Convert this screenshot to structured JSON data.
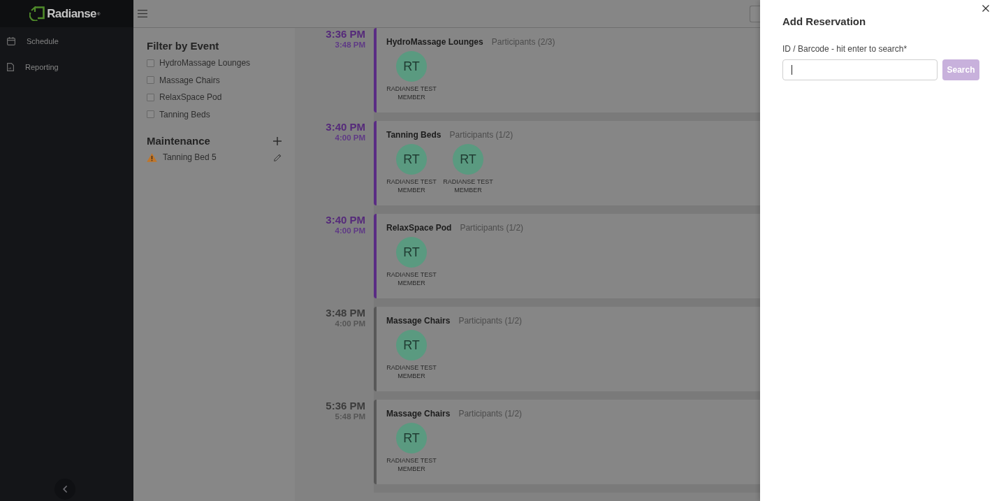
{
  "sidebar": {
    "logo": "Radianse$^{®}$",
    "items": [
      {
        "label": "Schedule",
        "kind": "calendar",
        "selected": false
      },
      {
        "label": "Reporting",
        "kind": "document",
        "selected": false
      }
    ]
  },
  "filter": {
    "title": "Filter by Event",
    "options": [
      {
        "label": "HydroMassage Lounges",
        "checked": false
      },
      {
        "label": "Massage Chairs",
        "checked": false
      },
      {
        "label": "RelaxSpace Pod",
        "checked": false
      },
      {
        "label": "Tanning Beds",
        "checked": false
      }
    ]
  },
  "maintenance": {
    "title": "Maintenance",
    "items": [
      {
        "label": "Tanning Bed 5"
      }
    ]
  },
  "events": [
    {
      "start": "3:36 PM",
      "end": "3:48 PM",
      "highlighted": true,
      "title": "HydroMassage Lounges",
      "participants_label": "Participants (2/3)",
      "participants": [
        {
          "initials": "RT",
          "name": "RADIANSE TEST MEMBER"
        }
      ]
    },
    {
      "start": "3:40 PM",
      "end": "4:00 PM",
      "highlighted": true,
      "title": "Tanning Beds",
      "participants_label": "Participants (1/2)",
      "participants": [
        {
          "initials": "RT",
          "name": "RADIANSE TEST MEMBER"
        },
        {
          "initials": "RT",
          "name": "RADIANSE TEST MEMBER"
        }
      ]
    },
    {
      "start": "3:40 PM",
      "end": "4:00 PM",
      "highlighted": true,
      "title": "RelaxSpace Pod",
      "participants_label": "Participants (1/2)",
      "participants": [
        {
          "initials": "RT",
          "name": "RADIANSE TEST MEMBER"
        }
      ]
    },
    {
      "start": "3:48 PM",
      "end": "4:00 PM",
      "highlighted": false,
      "title": "Massage Chairs",
      "participants_label": "Participants (1/2)",
      "participants": [
        {
          "initials": "RT",
          "name": "RADIANSE TEST MEMBER"
        }
      ]
    },
    {
      "start": "5:36 PM",
      "end": "5:48 PM",
      "highlighted": false,
      "title": "Massage Chairs",
      "participants_label": "Participants (1/2)",
      "participants": [
        {
          "initials": "RT",
          "name": "RADIANSE TEST MEMBER"
        }
      ]
    }
  ],
  "drawer": {
    "title": "Add Reservation",
    "field": {
      "label": "ID / Barcode - hit enter to search*",
      "focused": true
    },
    "search_button": {
      "label": "Search",
      "disabled": true
    }
  }
}
